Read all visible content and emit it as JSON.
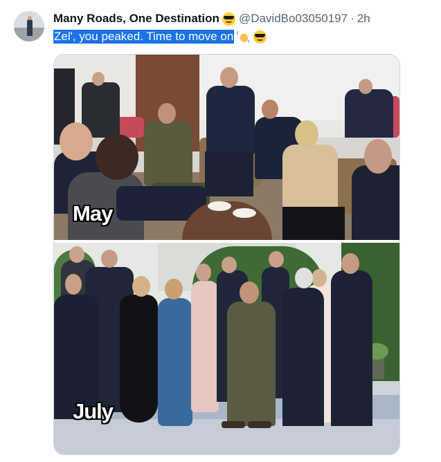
{
  "tweet": {
    "display_name": "Many Roads, One Destination",
    "name_emoji": "smiling-face-with-sunglasses",
    "handle": "@DavidBo03050197",
    "separator": "·",
    "time": "2h",
    "text": "Zel', you peaked. Time to move on",
    "text_emojis": [
      "waving-hand",
      "smiling-face-with-sunglasses"
    ]
  },
  "media": {
    "top_caption": "May",
    "bottom_caption": "July"
  },
  "colors": {
    "selection": "#1a73e8",
    "secondary_text": "#536471",
    "border": "#cfd9de"
  }
}
